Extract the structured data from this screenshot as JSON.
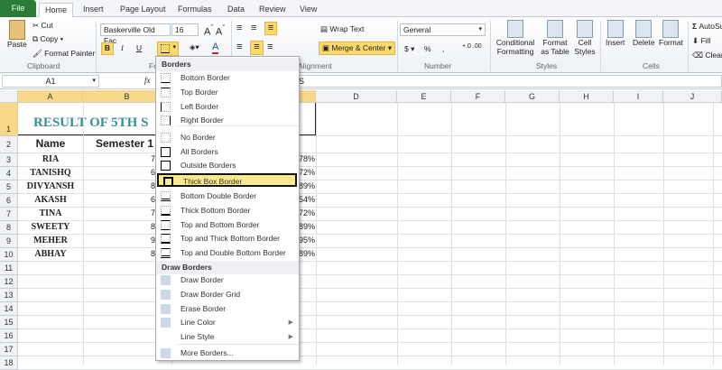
{
  "tabs": [
    "File",
    "Home",
    "Insert",
    "Page Layout",
    "Formulas",
    "Data",
    "Review",
    "View"
  ],
  "clipboard": {
    "paste": "Paste",
    "cut": "Cut",
    "copy": "Copy",
    "format_painter": "Format Painter",
    "group": "Clipboard"
  },
  "font": {
    "name": "Baskerville Old Fac",
    "size": "16",
    "bold": "B",
    "italic": "I",
    "underline": "U",
    "group": "Font"
  },
  "alignment": {
    "wrap": "Wrap Text",
    "merge": "Merge & Center",
    "group": "Alignment"
  },
  "number": {
    "format": "General",
    "currency": "$",
    "percent": "%",
    "comma": ",",
    "group": "Number"
  },
  "styles": {
    "conditional": "Conditional Formatting",
    "table": "Format as Table",
    "cell": "Cell Styles",
    "group": "Styles"
  },
  "cells": {
    "insert": "Insert",
    "delete": "Delete",
    "format": "Format",
    "group": "Cells"
  },
  "editing": {
    "autosum": "AutoSum",
    "fill": "Fill",
    "clear": "Clear"
  },
  "formula_bar": {
    "name_box": "A1",
    "fx": "fx",
    "content": "S"
  },
  "columns": [
    "A",
    "B",
    "C",
    "D",
    "E",
    "F",
    "G",
    "H",
    "I",
    "J"
  ],
  "rows": [
    "1",
    "2",
    "3",
    "4",
    "5",
    "6",
    "7",
    "8",
    "9",
    "10",
    "11",
    "12",
    "13",
    "14",
    "15",
    "16",
    "17",
    "18"
  ],
  "sheet": {
    "title": "RESULT OF 5TH S",
    "header": [
      "Name",
      "Semester 1"
    ],
    "names": [
      "RIA",
      "TANISHQ",
      "DIVYANSH",
      "AKASH",
      "TINA",
      "SWEETY",
      "MEHER",
      "ABHAY"
    ],
    "sem1_partial": [
      "7",
      "6",
      "8",
      "6",
      "7",
      "8",
      "9",
      "8"
    ],
    "pct_partial": [
      "78%",
      "72%",
      "89%",
      "54%",
      "72%",
      "89%",
      "95%",
      "89%"
    ]
  },
  "menu": {
    "header1": "Borders",
    "items1": [
      "Bottom Border",
      "Top Border",
      "Left Border",
      "Right Border",
      "No Border",
      "All Borders",
      "Outside Borders",
      "Thick Box Border",
      "Bottom Double Border",
      "Thick Bottom Border",
      "Top and Bottom Border",
      "Top and Thick Bottom Border",
      "Top and Double Bottom Border"
    ],
    "header2": "Draw Borders",
    "items2": [
      "Draw Border",
      "Draw Border Grid",
      "Erase Border",
      "Line Color",
      "Line Style",
      "More Borders..."
    ]
  },
  "colors": {
    "title": "#3b8f8f",
    "arrow": "#e0141b",
    "highlight": "#fbe98f"
  }
}
